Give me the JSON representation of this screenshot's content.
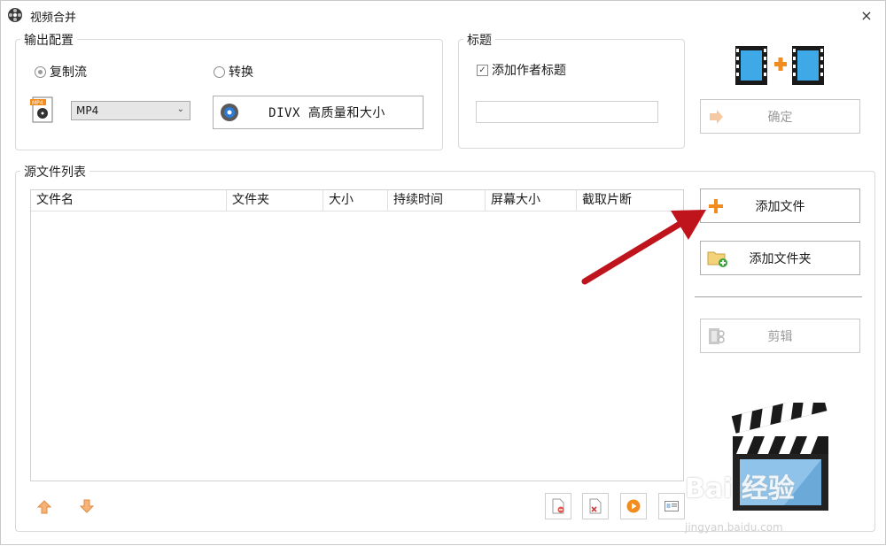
{
  "window": {
    "title": "视频合并",
    "close_glyph": "×"
  },
  "output_config": {
    "label": "输出配置",
    "radio_copy": "复制流",
    "radio_convert": "转换",
    "format_value": "MP4",
    "profile_button": "DIVX 高质量和大小"
  },
  "title_group": {
    "label": "标题",
    "add_author_title": "添加作者标题",
    "title_input_value": ""
  },
  "actions": {
    "ok": "确定",
    "add_file": "添加文件",
    "add_folder": "添加文件夹",
    "edit": "剪辑"
  },
  "source_list": {
    "label": "源文件列表",
    "columns": [
      "文件名",
      "文件夹",
      "大小",
      "持续时间",
      "屏幕大小",
      "截取片断"
    ]
  },
  "watermark": {
    "text": "Bai 经验",
    "url": "jingyan.baidu.com"
  },
  "colors": {
    "accent_orange": "#f28c1e",
    "arrow_red": "#c0141c",
    "disabled_text": "#9a9a9a"
  },
  "icons": [
    "film-reel-icon",
    "mp4-file-icon",
    "divx-icon",
    "film-merge-icon",
    "add-icon",
    "add-folder-icon",
    "film-edit-icon",
    "move-up-icon",
    "move-down-icon",
    "remove-icon",
    "delete-icon",
    "play-icon",
    "info-icon",
    "clapperboard-icon"
  ]
}
